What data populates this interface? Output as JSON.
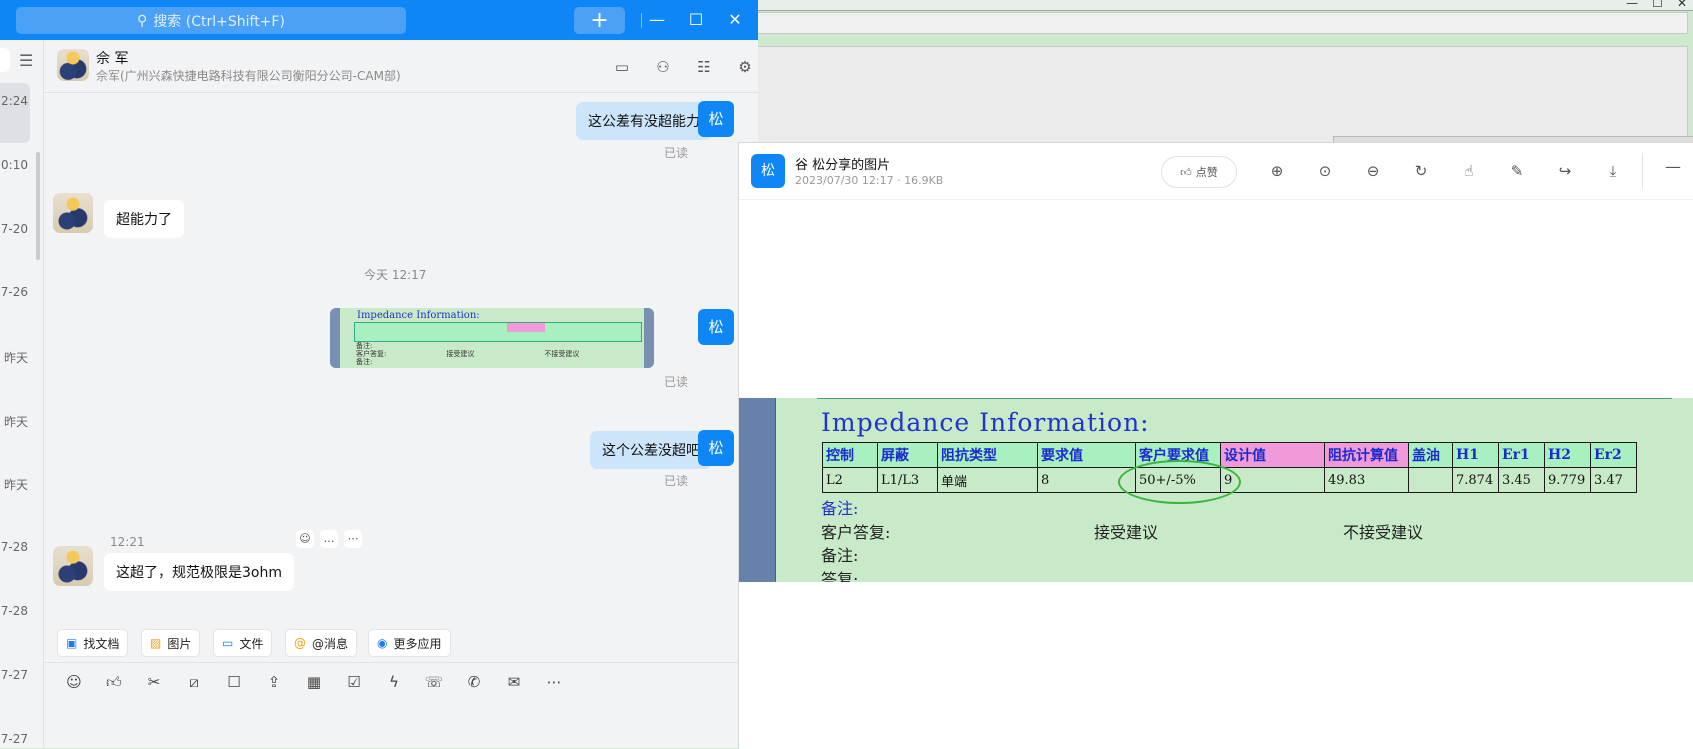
{
  "chat": {
    "search_placeholder": "搜索 (Ctrl+Shift+F)",
    "plus": "+",
    "window_controls": {
      "minimize": "—",
      "maximize": "☐",
      "close": "✕"
    },
    "header": {
      "name": "佘 军",
      "subtitle": "佘军(广州兴森快捷电路科技有限公司衡阳分公司-CAM部)"
    },
    "sidebar_times": [
      "2:24",
      "0:10",
      "7-20",
      "7-26",
      "昨天",
      "昨天",
      "昨天",
      "7-28",
      "7-28",
      "7-27",
      "7-27"
    ],
    "my_avatar_label": "松",
    "messages": [
      {
        "from": "me",
        "text": "这公差有没超能力",
        "status": "已读"
      },
      {
        "from": "other",
        "text": "超能力了"
      },
      {
        "time": "今天 12:17"
      },
      {
        "from": "me",
        "type": "image",
        "status": "已读"
      },
      {
        "from": "me",
        "text": "这个公差没超吧",
        "status": "已读"
      },
      {
        "from": "other",
        "time": "12:21",
        "text": "这超了，规范极限是3ohm"
      }
    ],
    "quick_actions": [
      "找文档",
      "图片",
      "文件",
      "@消息",
      "更多应用"
    ],
    "toolbar_icons": [
      "emoji-icon",
      "thumbs-up-icon",
      "scissors-icon",
      "slash-icon",
      "note-icon",
      "upload-icon",
      "calendar-icon",
      "checkbox-icon",
      "lightning-icon",
      "phone-icon",
      "call-icon",
      "mail-icon",
      "more-icon"
    ]
  },
  "viewer": {
    "avatar_label": "松",
    "title": "谷 松分享的图片",
    "meta": "2023/07/30 12:17 · 16.9KB",
    "like_label": "点赞"
  },
  "document": {
    "title": "Impedance Information:",
    "headers": [
      "控制",
      "屏蔽",
      "阻抗类型",
      "要求值",
      "客户要求值",
      "设计值",
      "阻抗计算值",
      "盖油",
      "H1",
      "Er1",
      "H2",
      "Er2"
    ],
    "row": [
      "L2",
      "L1/L3",
      "单端",
      "8",
      "50+/-5%",
      "9",
      "49.83",
      "",
      "7.874",
      "3.45",
      "9.779",
      "3.47"
    ],
    "remark_label": "备注:",
    "customer_reply_label": "客户答复:",
    "accept_label": "接受建议",
    "reject_label": "不接受建议",
    "remark2_label": "备注:",
    "reply_label": "答复:"
  },
  "thumbnail": {
    "title": "Impedance Information:",
    "line1": "备注:",
    "line2": "客户答复:",
    "accept": "接受建议",
    "reject": "不接受建议",
    "line3": "备注:"
  }
}
